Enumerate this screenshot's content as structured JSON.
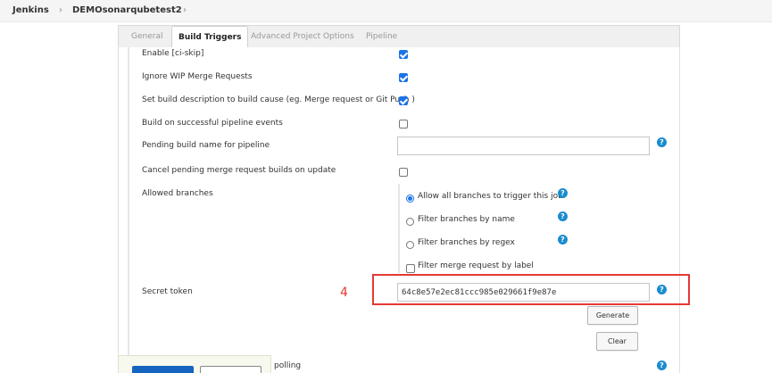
{
  "breadcrumb": {
    "root": "Jenkins",
    "job": "DEMOsonarqubetest2"
  },
  "tabs": [
    "General",
    "Build Triggers",
    "Advanced Project Options",
    "Pipeline"
  ],
  "options": {
    "enable_ci_skip": {
      "label": "Enable [ci-skip]",
      "checked": true
    },
    "ignore_wip": {
      "label": "Ignore WIP Merge Requests",
      "checked": true
    },
    "set_build_description": {
      "label": "Set build description to build cause (eg. Merge request or Git Push )",
      "checked": true
    },
    "build_on_pipeline": {
      "label": "Build on successful pipeline events",
      "checked": false
    },
    "pending_build_name": {
      "label": "Pending build name for pipeline",
      "value": ""
    },
    "cancel_pending": {
      "label": "Cancel pending merge request builds on update",
      "checked": false
    }
  },
  "allowed_branches": {
    "label": "Allowed branches",
    "choices": [
      "Allow all branches to trigger this job",
      "Filter branches by name",
      "Filter branches by regex"
    ],
    "selected": "Allow all branches to trigger this job",
    "filter_by_label": {
      "label": "Filter merge request by label",
      "checked": false
    }
  },
  "secret_token": {
    "label": "Secret token",
    "value": "64c8e57e2ec81ccc985e029661f9e87e",
    "generate_label": "Generate",
    "clear_label": "Clear"
  },
  "annotation_number": "4",
  "bottom_row_text": "polling",
  "colors": {
    "accent": "#1a73e8",
    "help": "#1a8ccf",
    "annotation": "#e53935"
  }
}
